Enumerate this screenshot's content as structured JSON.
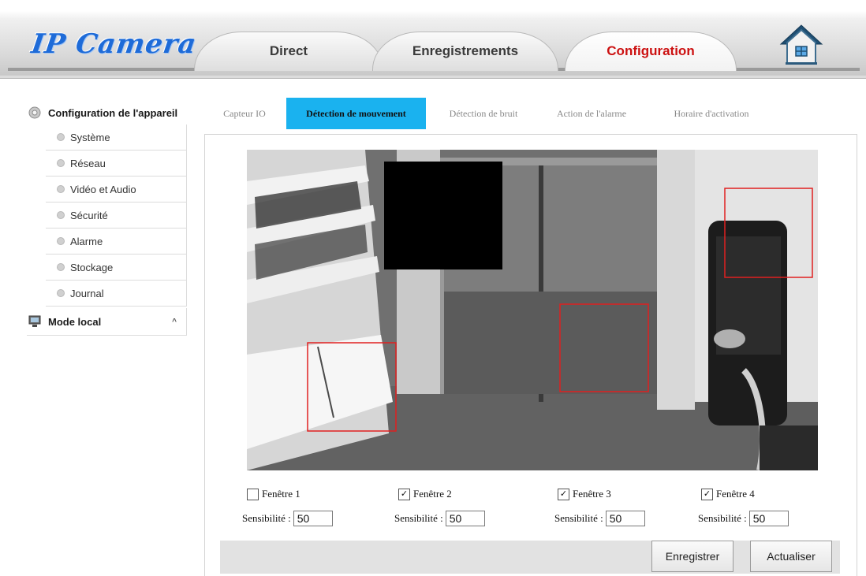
{
  "header": {
    "logo": "IP Camera",
    "tabs": [
      {
        "label": "Direct"
      },
      {
        "label": "Enregistrements"
      },
      {
        "label": "Configuration",
        "active": true
      }
    ],
    "active_color": "#cc1111"
  },
  "sidebar": {
    "group_label": "Configuration de l'appareil",
    "items": [
      {
        "label": "Système"
      },
      {
        "label": "Réseau"
      },
      {
        "label": "Vidéo et Audio"
      },
      {
        "label": "Sécurité"
      },
      {
        "label": "Alarme"
      },
      {
        "label": "Stockage"
      },
      {
        "label": "Journal"
      }
    ],
    "mode_label": "Mode local",
    "mode_caret": "^"
  },
  "subtabs": [
    {
      "label": "Capteur IO"
    },
    {
      "label": "Détection de mouvement",
      "active": true
    },
    {
      "label": "Détection de bruit"
    },
    {
      "label": "Action de l'alarme"
    },
    {
      "label": "Horaire d'activation"
    }
  ],
  "accent_color": "#1ab2ef",
  "zone_color": "#e02020",
  "windows": [
    {
      "label": "Fenêtre 1",
      "checked": false,
      "sens_label": "Sensibilité :",
      "sensitivity": "50"
    },
    {
      "label": "Fenêtre 2",
      "checked": true,
      "sens_label": "Sensibilité :",
      "sensitivity": "50"
    },
    {
      "label": "Fenêtre 3",
      "checked": true,
      "sens_label": "Sensibilité :",
      "sensitivity": "50"
    },
    {
      "label": "Fenêtre 4",
      "checked": true,
      "sens_label": "Sensibilité :",
      "sensitivity": "50"
    }
  ],
  "buttons": {
    "save": "Enregistrer",
    "refresh": "Actualiser"
  }
}
